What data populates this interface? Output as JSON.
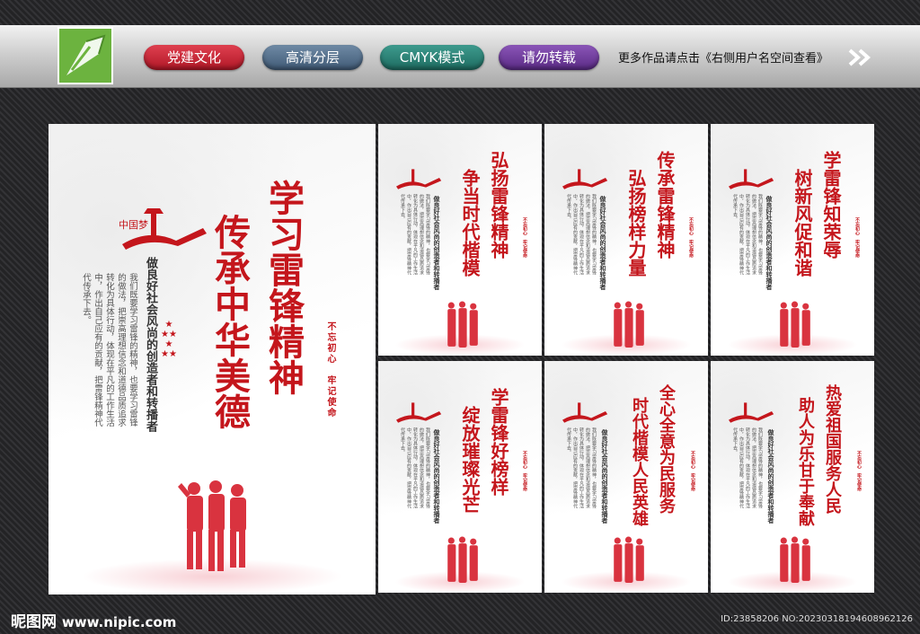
{
  "banner": {
    "tags": [
      "党建文化",
      "高清分层",
      "CMYK模式",
      "请勿转载"
    ],
    "more_text": "更多作品请点击《右侧用户名空间查看》",
    "logo_icon": "pen-nib-icon",
    "arrow_icon": "double-chevron-right-icon"
  },
  "colors": {
    "accent_red": "#c4161c",
    "logo_green": "#6cb33f"
  },
  "main_poster": {
    "title_1": "学习雷锋精神",
    "title_2": "传承中华美德",
    "subtitle": "做良好社会风尚的创造者和转播者",
    "seal": "不忘初心　牢记使命",
    "body": "我们既要学习雷锋的精神，也要学习雷锋的做法，把崇高理想信念和道德品质追求转化为具体行动，体现在平凡的工作生活中，作出自己应有的贡献，把雷锋精神代代传承下去。"
  },
  "small_posters": [
    {
      "title_1": "弘扬雷锋精神",
      "title_2": "争当时代楷模"
    },
    {
      "title_1": "传承雷锋精神",
      "title_2": "弘扬榜样力量"
    },
    {
      "title_1": "学雷锋知荣辱",
      "title_2": "树新风促和谐"
    },
    {
      "title_1": "学雷锋好榜样",
      "title_2": "绽放璀璨光芒"
    },
    {
      "title_1": "全心全意为民服务",
      "title_2": "时代楷模人民英雄"
    },
    {
      "title_1": "热爱祖国服务人民",
      "title_2": "助人为乐甘于奉献"
    }
  ],
  "small_common": {
    "subtitle": "做良好社会风尚的创造者和转播者",
    "seal": "不忘初心　牢记使命",
    "body": "我们既要学习雷锋的精神，也要学习雷锋的做法，把崇高理想信念和道德品质追求转化为具体行动，体现在平凡的工作生活中，作出自己应有的贡献，把雷锋精神代代传承下去。"
  },
  "footer": {
    "brand": "昵图网",
    "url": "www.nipic.com",
    "id_line": "ID:23858206 NO:20230318194608962126"
  }
}
